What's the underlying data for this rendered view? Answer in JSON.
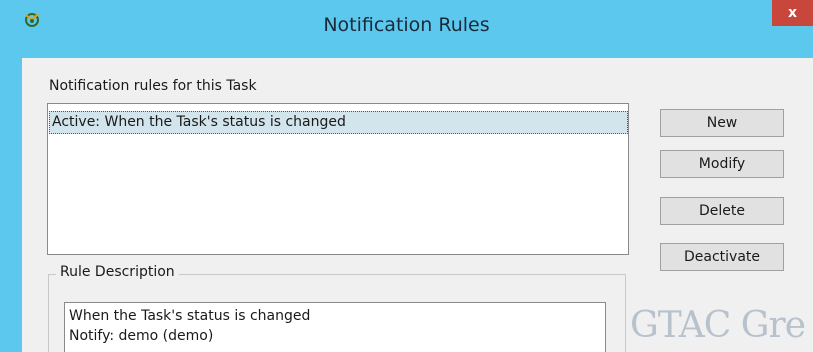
{
  "window": {
    "title": "Notification Rules",
    "close_label": "x",
    "colors": {
      "titlebar": "#5cc8ee",
      "close": "#c8463b",
      "selection": "#d2e4ec"
    }
  },
  "rules": {
    "label": "Notification rules for this Task",
    "items": [
      "Active: When the Task's status is changed"
    ]
  },
  "buttons": {
    "new": "New",
    "modify": "Modify",
    "delete": "Delete",
    "deactivate": "Deactivate"
  },
  "description": {
    "label": "Rule Description",
    "lines": [
      "When the Task's status is changed",
      "Notify: demo (demo)"
    ]
  },
  "watermark": {
    "text": "GTAC Gre"
  }
}
